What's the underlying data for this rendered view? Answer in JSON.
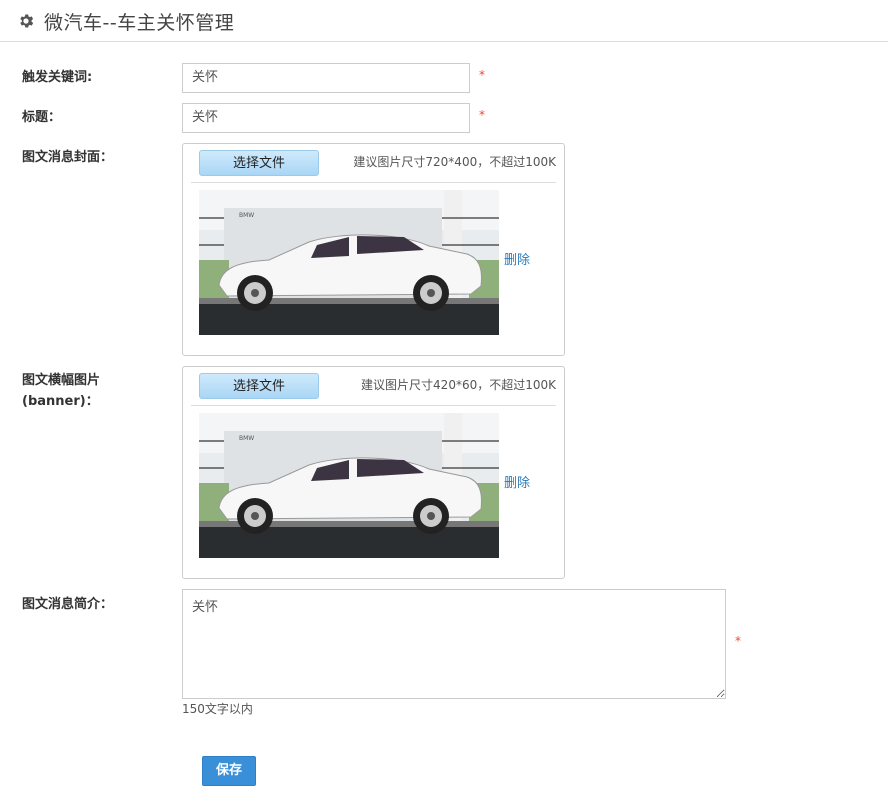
{
  "header": {
    "title": "微汽车--车主关怀管理",
    "icon": "gear-icon"
  },
  "form": {
    "keyword": {
      "label": "触发关键词:",
      "value": "关怀",
      "required_mark": "*"
    },
    "title": {
      "label": "标题：",
      "value": "关怀",
      "required_mark": "*"
    },
    "cover": {
      "label": "图文消息封面：",
      "button": "选择文件",
      "hint": "建议图片尺寸720*400，不超过100K",
      "delete": "删除",
      "image_logo_text": "BMW"
    },
    "banner": {
      "label_line1": "图文横幅图片",
      "label_line2": "(banner)：",
      "button": "选择文件",
      "hint": "建议图片尺寸420*60，不超过100K",
      "delete": "删除",
      "image_logo_text": "BMW"
    },
    "summary": {
      "label": "图文消息简介：",
      "value": "关怀",
      "required_mark": "*",
      "char_limit": "150文字以内"
    },
    "save_label": "保存"
  },
  "colors": {
    "accent": "#3a8fd9",
    "required": "#e74c3c",
    "link": "#2a7ab8"
  }
}
